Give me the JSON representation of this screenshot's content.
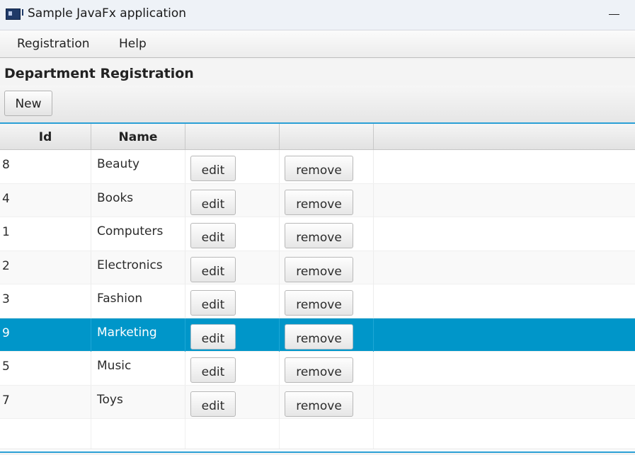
{
  "window": {
    "title": "Sample JavaFx application",
    "minimize_symbol": "—"
  },
  "menu": {
    "items": [
      {
        "label": "Registration"
      },
      {
        "label": "Help"
      }
    ]
  },
  "page": {
    "title": "Department Registration"
  },
  "toolbar": {
    "new_label": "New"
  },
  "table": {
    "columns": [
      "Id",
      "Name",
      "",
      ""
    ],
    "selected_id": "9",
    "rows": [
      {
        "id": "8",
        "name": "Beauty",
        "edit": "edit",
        "remove": "remove"
      },
      {
        "id": "4",
        "name": "Books",
        "edit": "edit",
        "remove": "remove"
      },
      {
        "id": "1",
        "name": "Computers",
        "edit": "edit",
        "remove": "remove"
      },
      {
        "id": "2",
        "name": "Electronics",
        "edit": "edit",
        "remove": "remove"
      },
      {
        "id": "3",
        "name": "Fashion",
        "edit": "edit",
        "remove": "remove"
      },
      {
        "id": "9",
        "name": "Marketing",
        "edit": "edit",
        "remove": "remove"
      },
      {
        "id": "5",
        "name": "Music",
        "edit": "edit",
        "remove": "remove"
      },
      {
        "id": "7",
        "name": "Toys",
        "edit": "edit",
        "remove": "remove"
      }
    ]
  },
  "colors": {
    "selection": "#0096c9",
    "accent_border": "#2a9fd6"
  },
  "icons": {
    "app": "java-app-icon",
    "minimize": "minimize-icon"
  }
}
